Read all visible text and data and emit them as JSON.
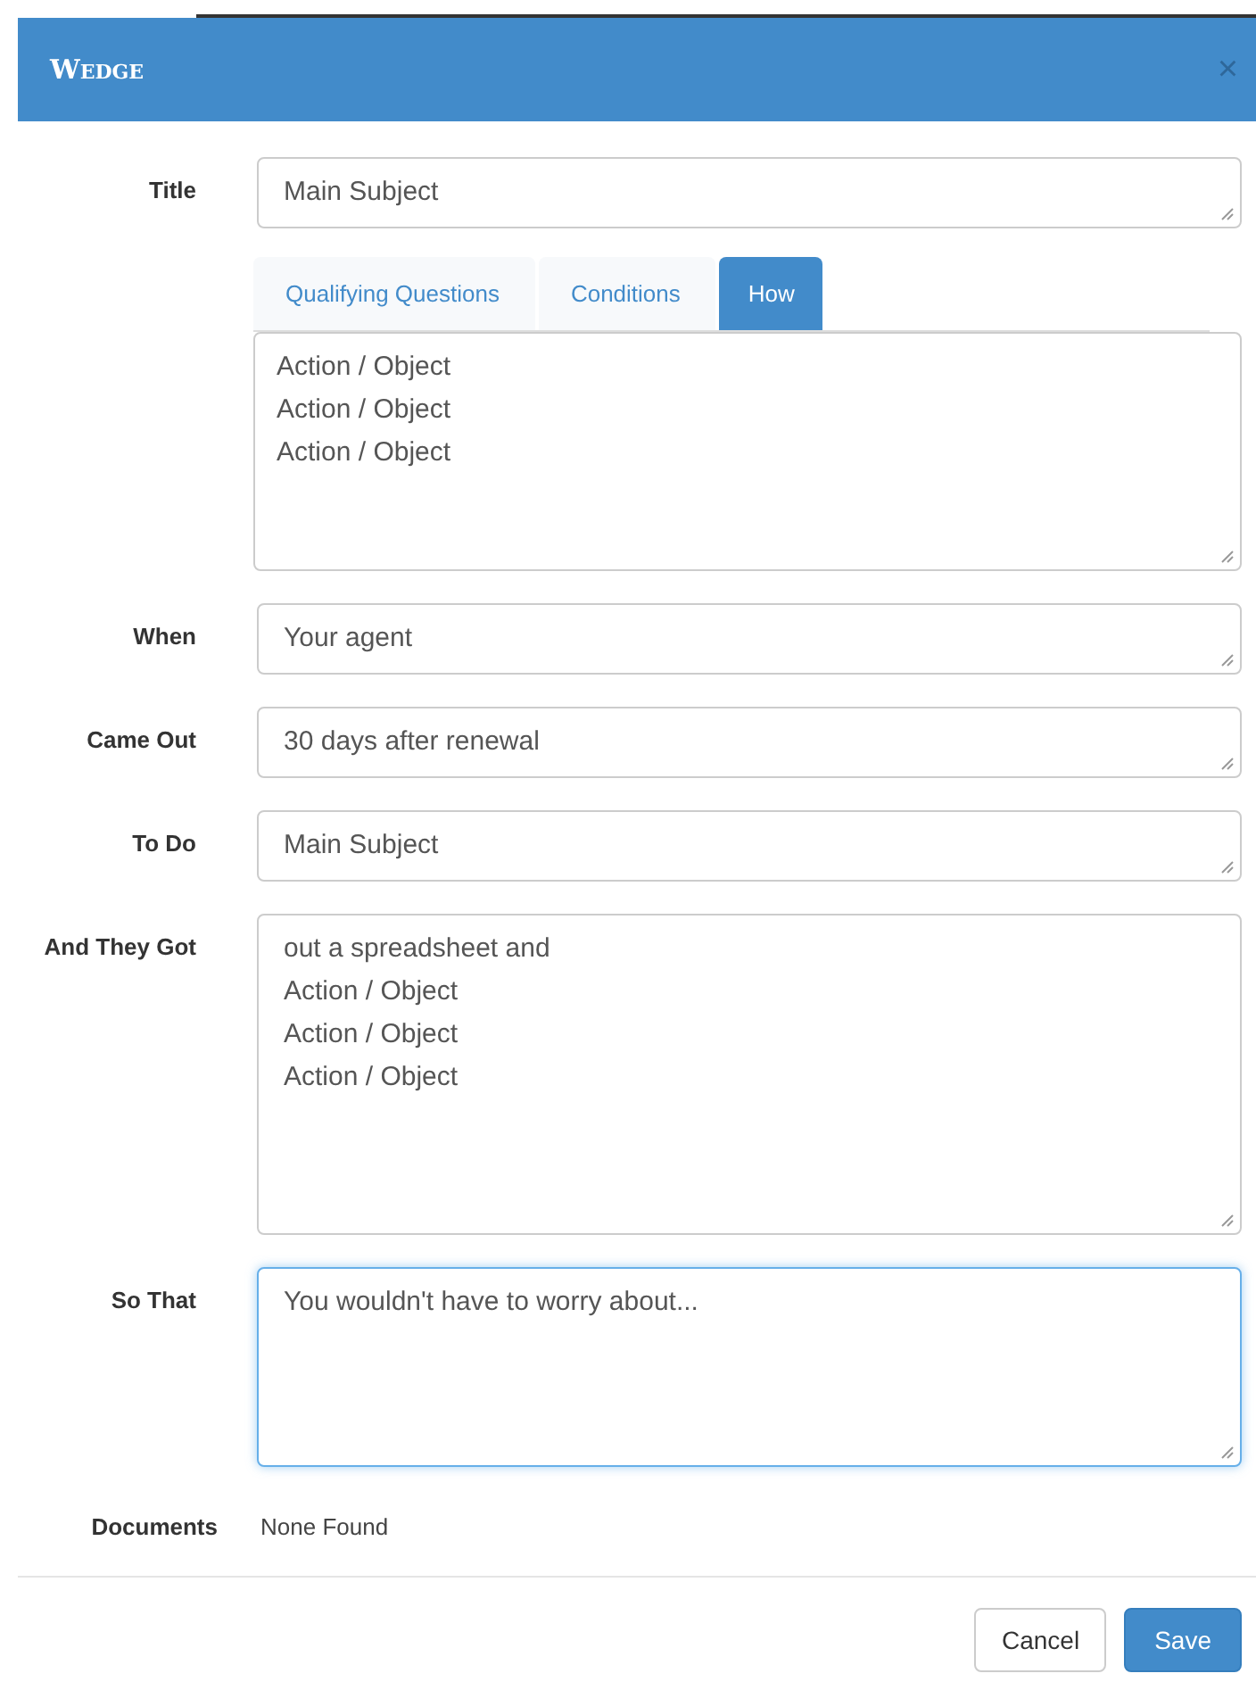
{
  "dialog": {
    "title": "Wedge",
    "close": "×"
  },
  "fields": [
    {
      "kind": "input",
      "label": "Title",
      "value": "Main Subject",
      "focused": false
    },
    {
      "kind": "tabs",
      "tabs": [
        {
          "label": "Qualifying Questions",
          "selected": false
        },
        {
          "label": "Conditions",
          "selected": false
        },
        {
          "label": "How",
          "selected": true
        }
      ],
      "value": "Action / Object\nAction / Object\nAction / Object",
      "focused": false
    },
    {
      "kind": "input",
      "label": "When",
      "value": "Your agent",
      "focused": false
    },
    {
      "kind": "input",
      "label": "Came Out",
      "value": "30 days after renewal",
      "focused": false
    },
    {
      "kind": "input",
      "label": "To Do",
      "value": "Main Subject",
      "focused": false
    },
    {
      "kind": "textarea",
      "label": "And They Got",
      "value": "out a spreadsheet and\nAction / Object\nAction / Object\nAction / Object",
      "focused": false
    },
    {
      "kind": "textarea",
      "label": "So That",
      "value": "You wouldn't have to worry about...",
      "focused": true
    }
  ],
  "documents": {
    "label": "Documents",
    "value": "None Found"
  },
  "buttons": [
    {
      "label": "Cancel",
      "kind": "default"
    },
    {
      "label": "Save",
      "kind": "primary"
    }
  ]
}
